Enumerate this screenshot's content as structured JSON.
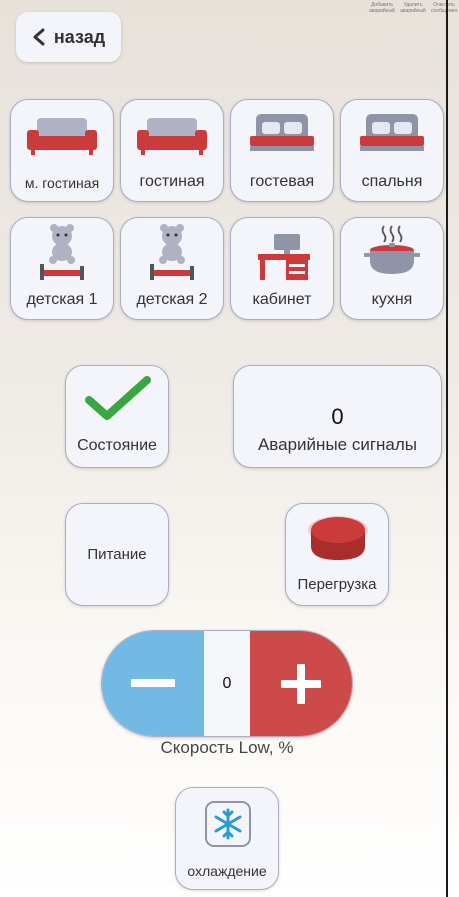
{
  "header": {
    "back_label": "назад",
    "corner_labels": [
      "Добавить аварийный",
      "Удалить аварийный",
      "Очистить сообщения"
    ]
  },
  "rooms": [
    {
      "label": "м. гостиная",
      "icon": "sofa-icon"
    },
    {
      "label": "гостиная",
      "icon": "sofa-icon"
    },
    {
      "label": "гостевая",
      "icon": "bed-icon"
    },
    {
      "label": "спальня",
      "icon": "bed-icon"
    },
    {
      "label": "детская 1",
      "icon": "kids-bed-icon"
    },
    {
      "label": "детская 2",
      "icon": "kids-bed-icon"
    },
    {
      "label": "кабинет",
      "icon": "desk-icon"
    },
    {
      "label": "кухня",
      "icon": "pot-icon"
    }
  ],
  "status": {
    "label": "Состояние",
    "icon": "checkmark-icon",
    "color": "#3aa63f"
  },
  "alarms": {
    "count": "0",
    "label": "Аварийные сигналы"
  },
  "power": {
    "label": "Питание"
  },
  "overload": {
    "label": "Перегрузка",
    "icon": "red-button-icon",
    "color": "#cc3b3b"
  },
  "speed": {
    "value": "0",
    "label": "Скорость Low, %",
    "minus_color": "#72b9e4",
    "plus_color": "#cc4a4a"
  },
  "cooling": {
    "label": "охлаждение",
    "icon": "snowflake-icon"
  }
}
